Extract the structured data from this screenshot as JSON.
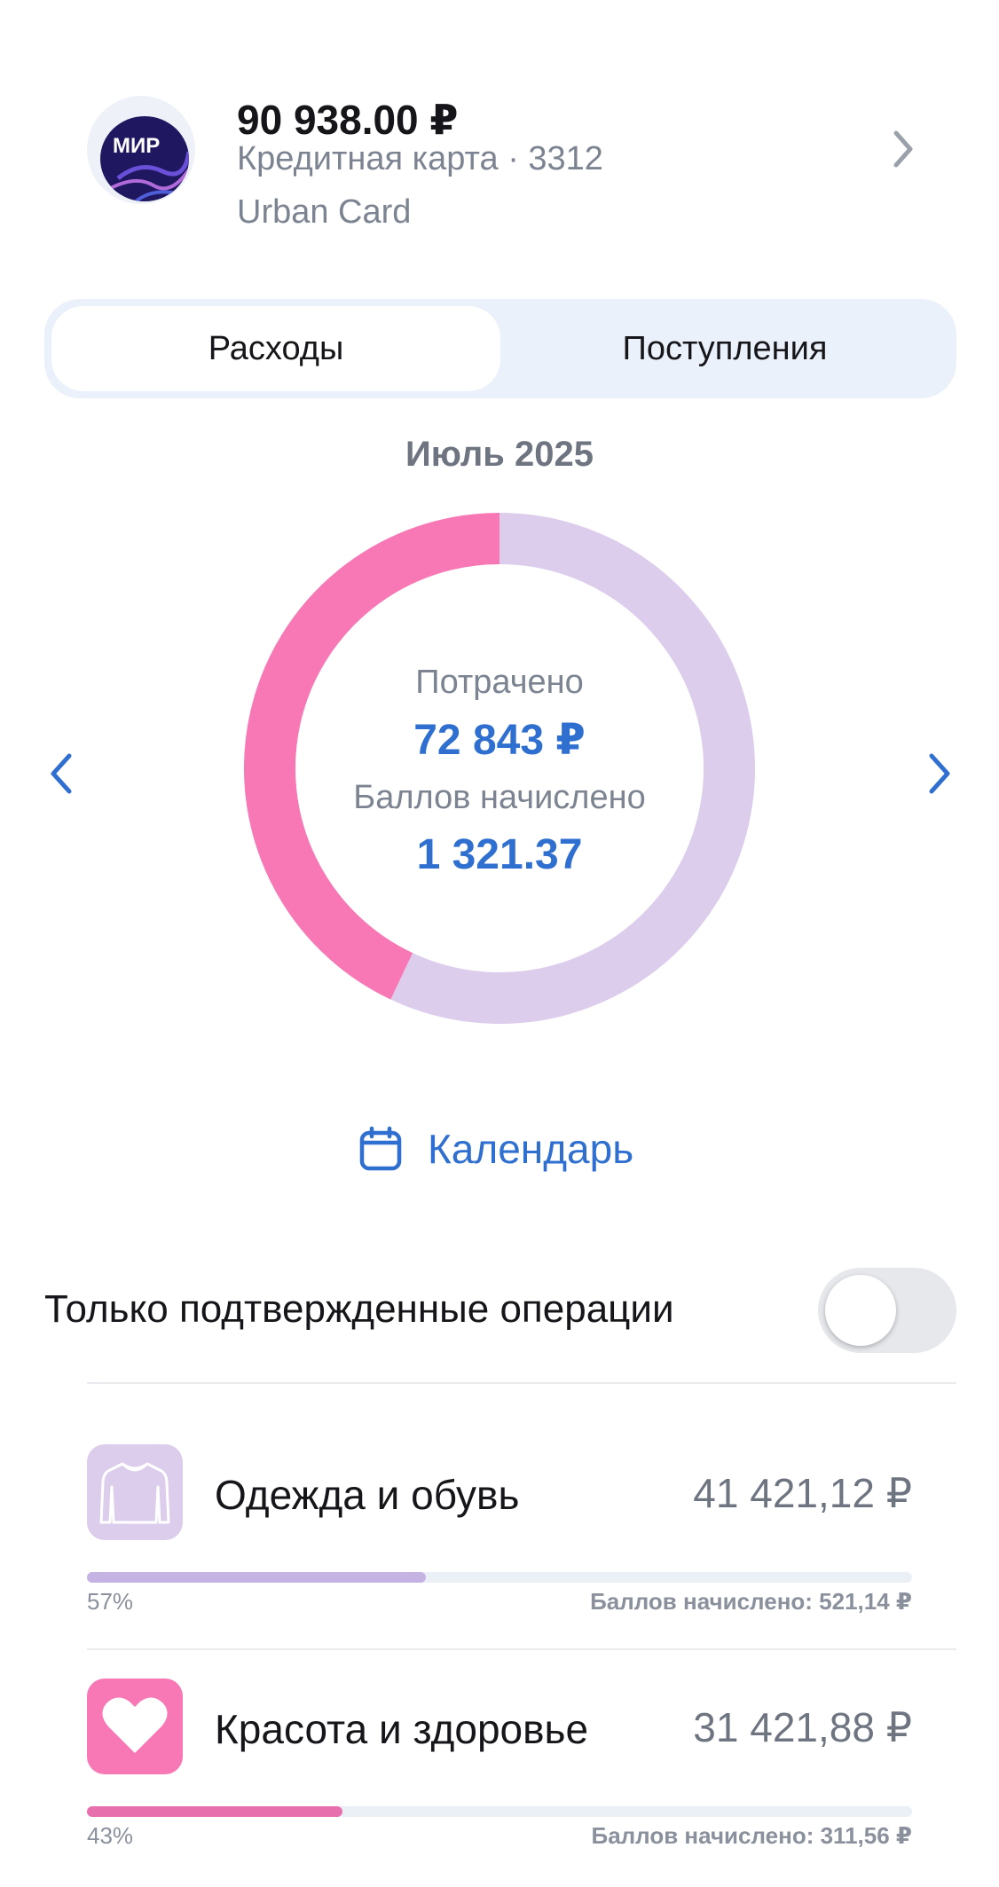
{
  "card": {
    "balance": "90 938.00 ₽",
    "type_line": "Кредитная карта · 3312",
    "name": "Urban Card",
    "logo_text": "МИР"
  },
  "tabs": [
    {
      "label": "Расходы",
      "active": true
    },
    {
      "label": "Поступления",
      "active": false
    }
  ],
  "period": "Июль 2025",
  "summary": {
    "spent_label": "Потрачено",
    "spent_value": "72 843 ₽",
    "points_label": "Баллов начислено",
    "points_value": "1 321.37"
  },
  "calendar_label": "Календарь",
  "toggle": {
    "label": "Только подтвержденные операции",
    "on": false
  },
  "categories": [
    {
      "name": "Одежда и обувь",
      "amount": "41 421,12 ₽",
      "percent_label": "57%",
      "percent": 57,
      "points": "Баллов начислено: 521,14 ₽",
      "icon": "sweater-icon",
      "color": "#dccdec",
      "bar_color": "#c5b4e3"
    },
    {
      "name": "Красота и здоровье",
      "amount": "31 421,88 ₽",
      "percent_label": "43%",
      "percent": 43,
      "points": "Баллов начислено: 311,56 ₽",
      "icon": "heart-icon",
      "color": "#f778b5",
      "bar_color": "#e86fae"
    }
  ],
  "chart_data": {
    "type": "pie",
    "categories": [
      "Одежда и обувь",
      "Красота и здоровье"
    ],
    "values": [
      57,
      43
    ],
    "colors": [
      "#dccdec",
      "#f778b5"
    ]
  }
}
